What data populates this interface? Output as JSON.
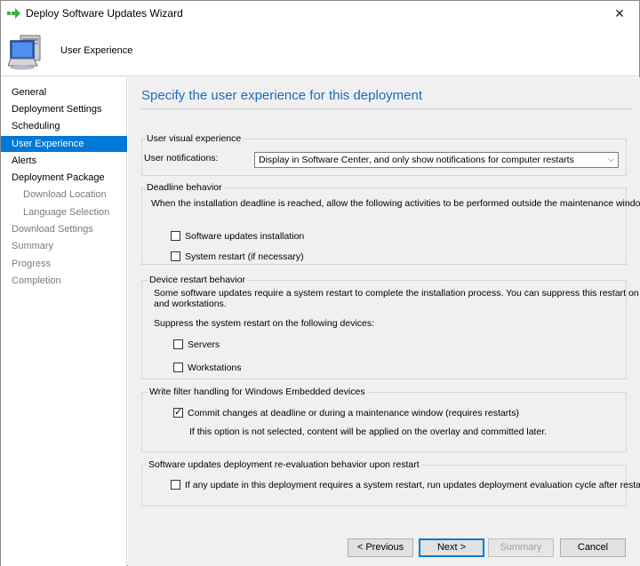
{
  "window": {
    "title": "Deploy Software Updates Wizard"
  },
  "header": {
    "title": "User Experience"
  },
  "sidebar": {
    "items": [
      {
        "label": "General"
      },
      {
        "label": "Deployment Settings"
      },
      {
        "label": "Scheduling"
      },
      {
        "label": "User Experience"
      },
      {
        "label": "Alerts"
      },
      {
        "label": "Deployment Package"
      },
      {
        "label": "Download Location"
      },
      {
        "label": "Language Selection"
      },
      {
        "label": "Download Settings"
      },
      {
        "label": "Summary"
      },
      {
        "label": "Progress"
      },
      {
        "label": "Completion"
      }
    ]
  },
  "main": {
    "title": "Specify the user experience for this deployment",
    "visual": {
      "legend": "User visual experience",
      "notifications_label": "User notifications:",
      "notifications_value": "Display in Software Center, and only show notifications for computer restarts"
    },
    "deadline": {
      "legend": "Deadline behavior",
      "description": "When the installation deadline is reached, allow the following activities to be performed outside the maintenance window:",
      "opt_install": "Software updates installation",
      "opt_restart": "System restart (if necessary)"
    },
    "restart": {
      "legend": "Device restart behavior",
      "description_line1": "Some software updates require a system restart to complete the installation process. You can suppress this restart on servers",
      "description_line2": "and workstations.",
      "suppress_label": "Suppress the system restart on the following devices:",
      "opt_servers": "Servers",
      "opt_workstations": "Workstations"
    },
    "writefilter": {
      "legend": "Write filter handling for Windows Embedded devices",
      "opt_commit": "Commit changes at deadline or during a maintenance window (requires restarts)",
      "note": "If this option is not selected, content will be applied on the overlay and committed later."
    },
    "reeval": {
      "legend": "Software updates deployment re-evaluation behavior upon restart",
      "opt_reeval": "If any update in this deployment requires a system restart, run updates deployment evaluation cycle after restart"
    }
  },
  "footer": {
    "previous": "< Previous",
    "next": "Next >",
    "summary": "Summary",
    "cancel": "Cancel"
  },
  "colors": {
    "accent": "#0078d7",
    "title": "#1e6bb8"
  }
}
